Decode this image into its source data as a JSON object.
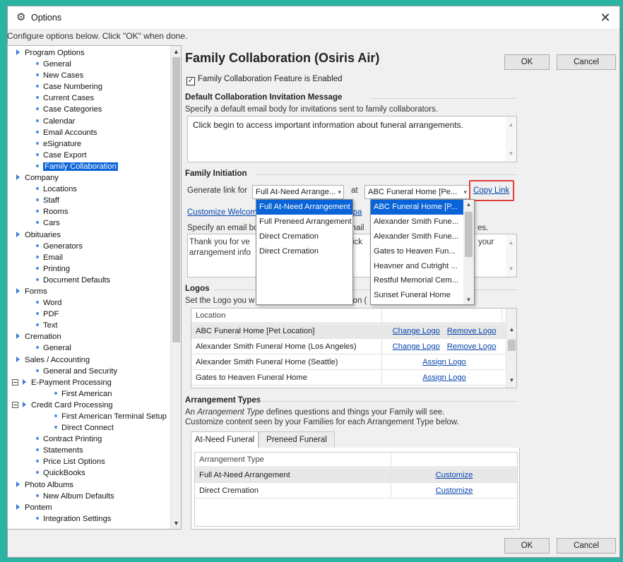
{
  "window": {
    "title": "Options",
    "close_glyph": "✕"
  },
  "subtitle": "Configure options below.  Click \"OK\" when done.",
  "tree": [
    {
      "label": "Program Options",
      "level": 0,
      "marker": "tri"
    },
    {
      "label": "General",
      "level": 1,
      "marker": "dot"
    },
    {
      "label": "New Cases",
      "level": 1,
      "marker": "dot"
    },
    {
      "label": "Case Numbering",
      "level": 1,
      "marker": "dot"
    },
    {
      "label": "Current Cases",
      "level": 1,
      "marker": "dot"
    },
    {
      "label": "Case Categories",
      "level": 1,
      "marker": "dot"
    },
    {
      "label": "Calendar",
      "level": 1,
      "marker": "dot"
    },
    {
      "label": "Email Accounts",
      "level": 1,
      "marker": "dot"
    },
    {
      "label": "eSignature",
      "level": 1,
      "marker": "dot"
    },
    {
      "label": "Case Export",
      "level": 1,
      "marker": "dot"
    },
    {
      "label": "Family Collaboration",
      "level": 1,
      "marker": "dot",
      "selected": true
    },
    {
      "label": "Company",
      "level": 0,
      "marker": "tri"
    },
    {
      "label": "Locations",
      "level": 1,
      "marker": "dot"
    },
    {
      "label": "Staff",
      "level": 1,
      "marker": "dot"
    },
    {
      "label": "Rooms",
      "level": 1,
      "marker": "dot"
    },
    {
      "label": "Cars",
      "level": 1,
      "marker": "dot"
    },
    {
      "label": "Obituaries",
      "level": 0,
      "marker": "tri"
    },
    {
      "label": "Generators",
      "level": 1,
      "marker": "dot"
    },
    {
      "label": "Email",
      "level": 1,
      "marker": "dot"
    },
    {
      "label": "Printing",
      "level": 1,
      "marker": "dot"
    },
    {
      "label": "Document Defaults",
      "level": 1,
      "marker": "dot"
    },
    {
      "label": "Forms",
      "level": 0,
      "marker": "tri"
    },
    {
      "label": "Word",
      "level": 1,
      "marker": "dot"
    },
    {
      "label": "PDF",
      "level": 1,
      "marker": "dot"
    },
    {
      "label": "Text",
      "level": 1,
      "marker": "dot"
    },
    {
      "label": "Cremation",
      "level": 0,
      "marker": "tri"
    },
    {
      "label": "General",
      "level": 1,
      "marker": "dot"
    },
    {
      "label": "Sales / Accounting",
      "level": 0,
      "marker": "tri"
    },
    {
      "label": "General and Security",
      "level": 1,
      "marker": "dot"
    },
    {
      "label": "E-Payment Processing",
      "level": 0,
      "marker": "tri",
      "box": true
    },
    {
      "label": "First American",
      "level": 2,
      "marker": "dot"
    },
    {
      "label": "Credit Card Processing",
      "level": 0,
      "marker": "tri",
      "box": true
    },
    {
      "label": "First American Terminal Setup",
      "level": 2,
      "marker": "dot"
    },
    {
      "label": "Direct Connect",
      "level": 2,
      "marker": "dot"
    },
    {
      "label": "Contract Printing",
      "level": 1,
      "marker": "dot"
    },
    {
      "label": "Statements",
      "level": 1,
      "marker": "dot"
    },
    {
      "label": "Price List Options",
      "level": 1,
      "marker": "dot"
    },
    {
      "label": "QuickBooks",
      "level": 1,
      "marker": "dot"
    },
    {
      "label": "Photo Albums",
      "level": 0,
      "marker": "tri"
    },
    {
      "label": "New Album Defaults",
      "level": 1,
      "marker": "dot"
    },
    {
      "label": "Pontem",
      "level": 0,
      "marker": "tri"
    },
    {
      "label": "Integration Settings",
      "level": 1,
      "marker": "dot"
    }
  ],
  "header": {
    "title": "Family Collaboration (Osiris Air)",
    "ok": "OK",
    "cancel": "Cancel"
  },
  "feature": {
    "checked_glyph": "✓",
    "label": "Family Collaboration Feature is Enabled"
  },
  "invitation": {
    "heading": "Default Collaboration Invitation Message",
    "desc": "Specify a default email body for invitations sent to family collaborators.",
    "body": "Click begin to access important information about funeral arrangements."
  },
  "initiation": {
    "heading": "Family Initiation",
    "generate_label": "Generate link for",
    "arrangement_value": "Full At-Need Arrange...",
    "at_label": "at",
    "location_value": "ABC Funeral Home [Pe...",
    "copy_link": "Copy Link",
    "customize_link": "Customize Welcom",
    "customize_link_tail": "u pa",
    "email_desc_head": "Specify an email bo",
    "email_desc_mid": "email",
    "email_desc_tail": "es.",
    "body_line1_head": "Thank you for ve",
    "body_line1_mid": "Click",
    "body_line1_tail": "your",
    "body_line2_head": "arrangement info",
    "arrangement_options": [
      "Full At-Need Arrangement",
      "Full Preneed Arrangement",
      "Direct Cremation",
      "Direct Cremation"
    ],
    "location_options": [
      "ABC Funeral Home [P...",
      "Alexander Smith Fune...",
      "Alexander Smith Fune...",
      "Gates to Heaven Fun...",
      "Heavner and Cutright ...",
      "Restful Memorial Cem...",
      "Sunset Funeral Home"
    ]
  },
  "logos": {
    "heading": "Logos",
    "desc_head": "Set the Logo you w",
    "desc_tail": "ion (",
    "col_location": "Location",
    "rows": [
      {
        "location": "ABC Funeral Home [Pet Location]",
        "actions": [
          "Change Logo",
          "Remove Logo"
        ]
      },
      {
        "location": "Alexander Smith Funeral Home (Los Angeles)",
        "actions": [
          "Change Logo",
          "Remove Logo"
        ]
      },
      {
        "location": "Alexander Smith Funeral Home (Seattle)",
        "actions": [
          "Assign Logo"
        ]
      },
      {
        "location": "Gates to Heaven Funeral Home",
        "actions": [
          "Assign Logo"
        ]
      }
    ]
  },
  "arrangement_types": {
    "heading": "Arrangement Types",
    "desc_pre": "An ",
    "desc_em": "Arrangement Type",
    "desc_post": " defines questions and things your Family will see.",
    "desc2": "Customize content seen by your Families for each Arrangement Type below.",
    "tabs": [
      "At-Need Funeral",
      "Preneed Funeral"
    ],
    "col_type": "Arrangement Type",
    "rows": [
      {
        "type": "Full At-Need Arrangement",
        "action": "Customize"
      },
      {
        "type": "Direct Cremation",
        "action": "Customize"
      }
    ]
  },
  "footer": {
    "ok": "OK",
    "cancel": "Cancel"
  }
}
